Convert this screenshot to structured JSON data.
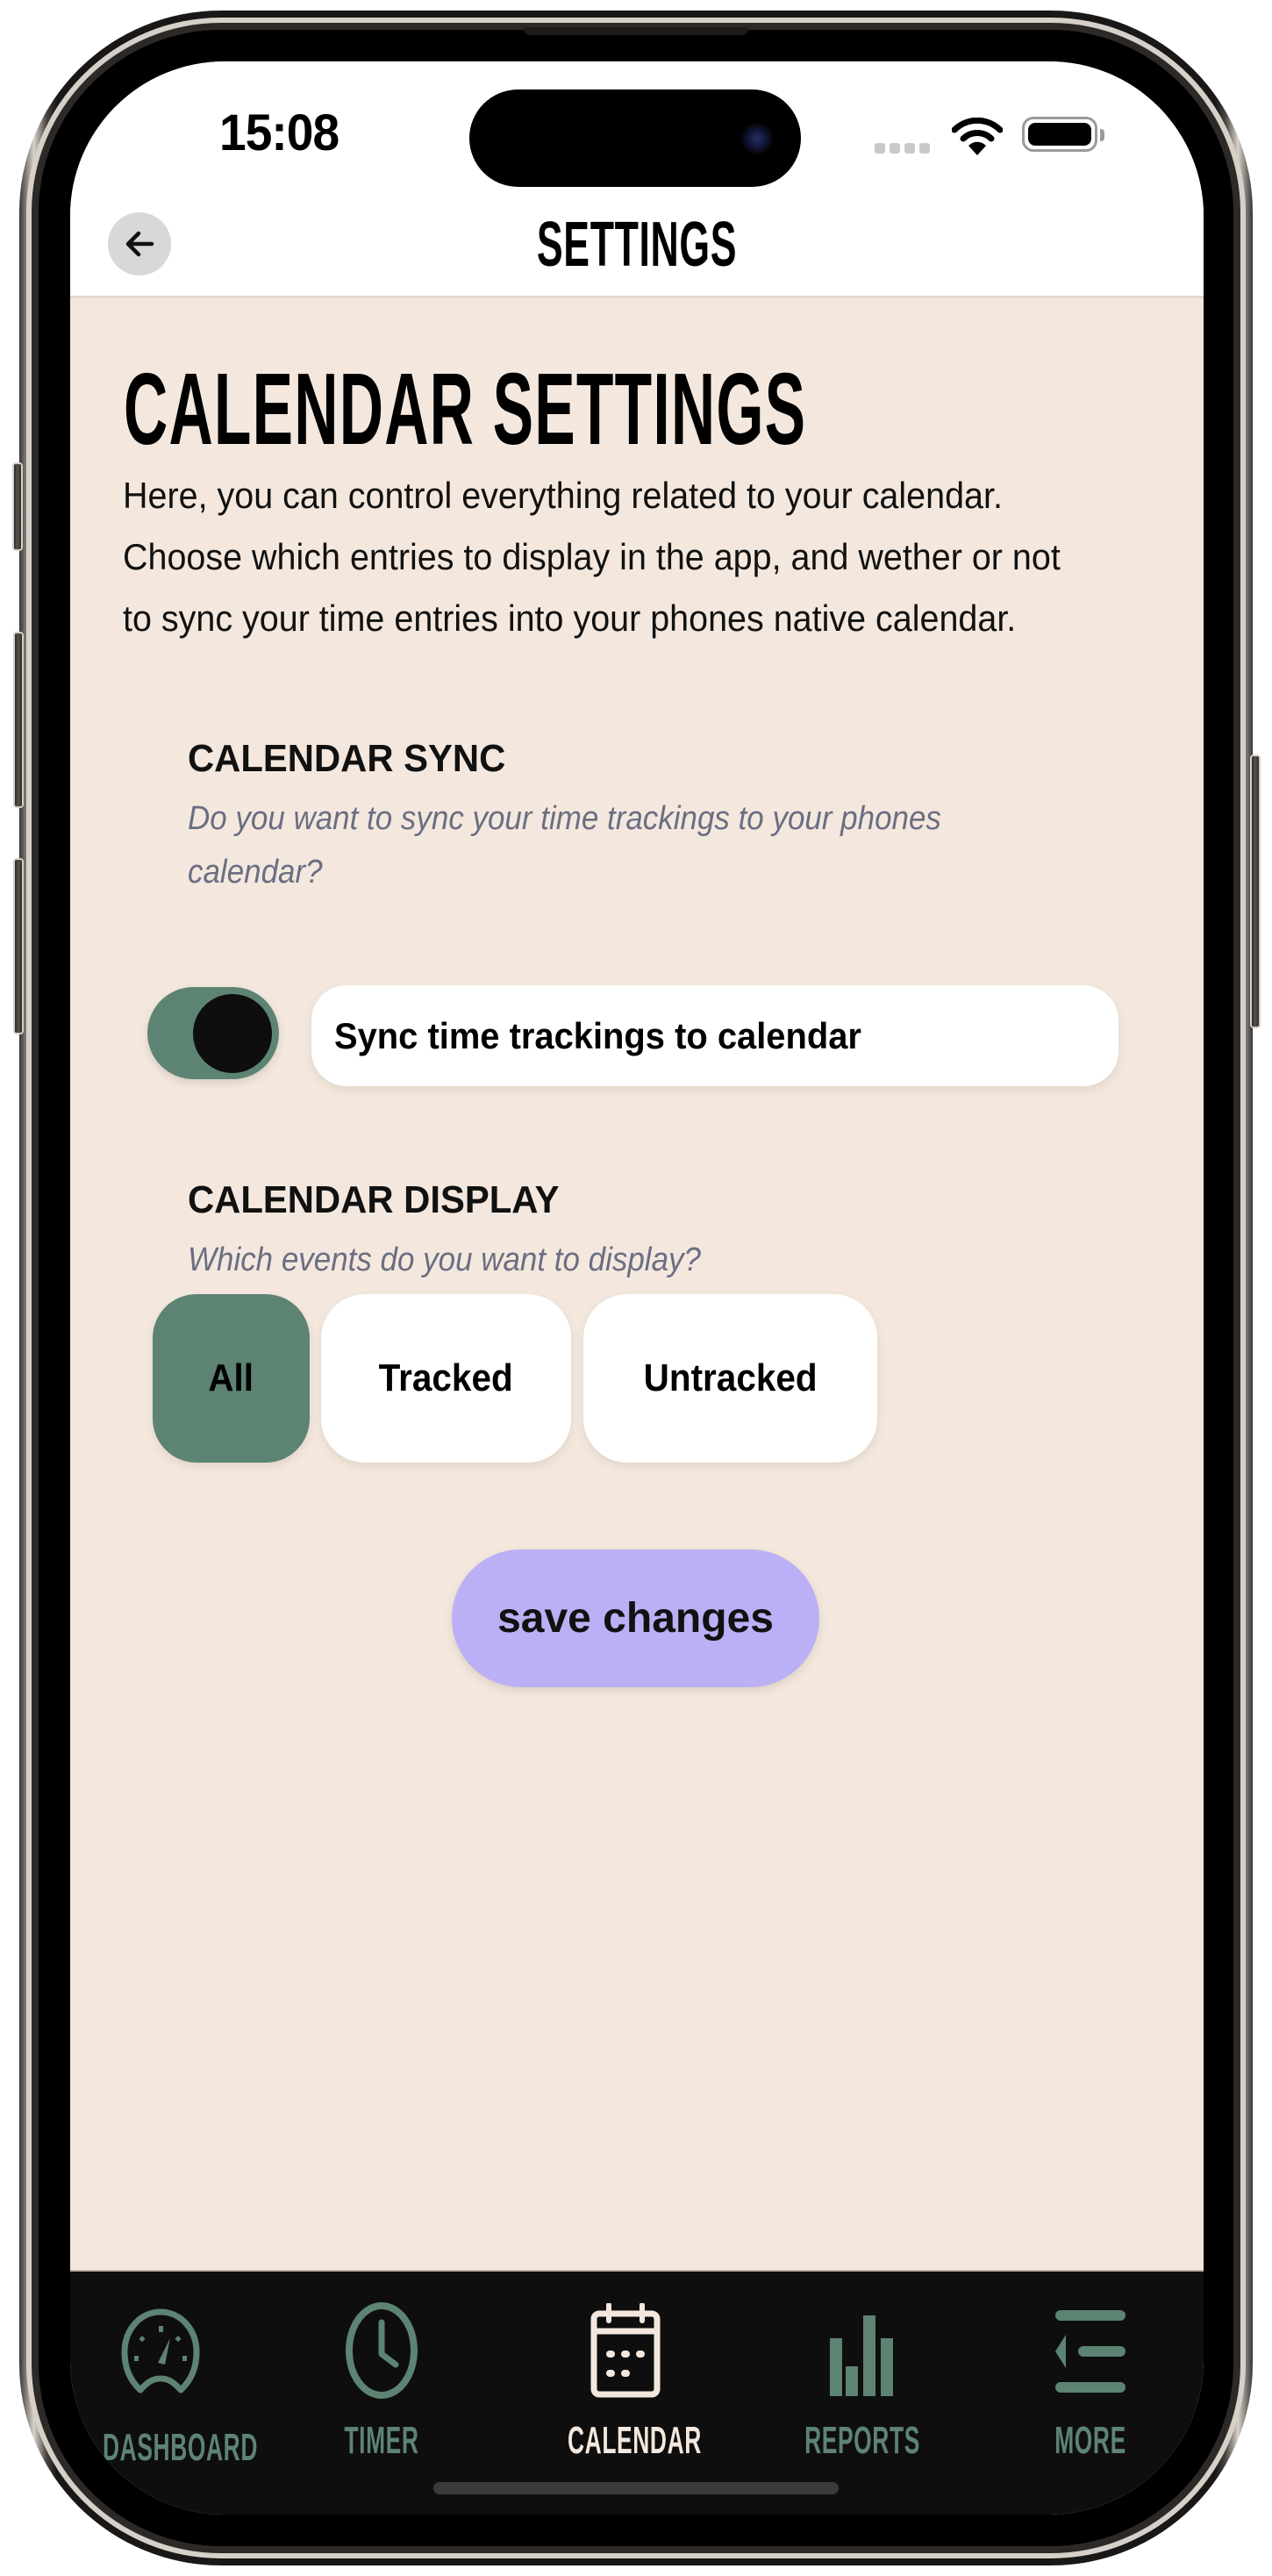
{
  "status_bar": {
    "time": "15:08",
    "wifi_icon": "wifi-icon",
    "battery_icon": "battery-icon",
    "signal_icon": "cellular-signal-icon"
  },
  "header": {
    "back_icon": "arrow-left-icon",
    "title": "SETTINGS"
  },
  "page": {
    "title": "CALENDAR SETTINGS",
    "intro": "Here, you can control everything related to your calendar. Choose which entries to display in the app, and wether or not to sync your time entries into your phones native calendar."
  },
  "calendar_sync": {
    "title": "CALENDAR SYNC",
    "subtitle": "Do you want to sync your time trackings to your phones calendar?",
    "toggle_on": true,
    "toggle_label": "Sync time trackings to calendar"
  },
  "calendar_display": {
    "title": "CALENDAR DISPLAY",
    "subtitle": "Which events do you want to display?",
    "options": [
      {
        "label": "All",
        "selected": true
      },
      {
        "label": "Tracked",
        "selected": false
      },
      {
        "label": "Untracked",
        "selected": false
      }
    ]
  },
  "save_button": {
    "label": "save changes"
  },
  "tab_bar": {
    "items": [
      {
        "label": "DASHBOARD",
        "icon": "speedometer-icon",
        "active": false
      },
      {
        "label": "TIMER",
        "icon": "clock-icon",
        "active": false
      },
      {
        "label": "CALENDAR",
        "icon": "calendar-icon",
        "active": true
      },
      {
        "label": "REPORTS",
        "icon": "bar-chart-icon",
        "active": false
      },
      {
        "label": "MORE",
        "icon": "menu-collapse-icon",
        "active": false
      }
    ]
  },
  "colors": {
    "background": "#f4e8de",
    "accent_green": "#5d8373",
    "save_purple": "#bbb0f6",
    "tab_bar": "#0e0e0e",
    "tab_active": "#f4e8de",
    "subtitle_gray": "#6b6e82"
  }
}
